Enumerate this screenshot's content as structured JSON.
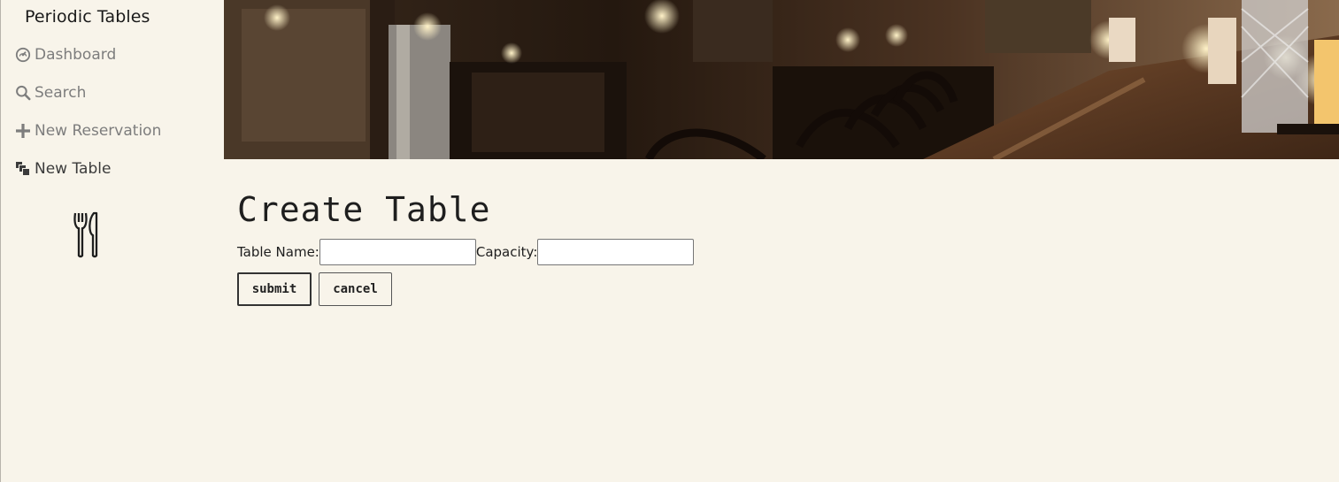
{
  "sidebar": {
    "brand": "Periodic Tables",
    "items": [
      {
        "label": "Dashboard",
        "icon": "dashboard-icon"
      },
      {
        "label": "Search",
        "icon": "search-icon"
      },
      {
        "label": "New Reservation",
        "icon": "plus-icon"
      },
      {
        "label": "New Table",
        "icon": "table-stack-icon"
      }
    ],
    "logo_icon": "fork-knife-icon"
  },
  "hero": {
    "description_icon": "restaurant-interior-photo"
  },
  "main": {
    "title": "Create Table",
    "form": {
      "table_name_label": "Table Name:",
      "table_name_value": "",
      "capacity_label": "Capacity:",
      "capacity_value": ""
    },
    "buttons": {
      "submit": "submit",
      "cancel": "cancel"
    }
  },
  "colors": {
    "background": "#f8f4ea",
    "nav_text": "#7d7d7d",
    "active_nav_text": "#3b3b3b"
  }
}
